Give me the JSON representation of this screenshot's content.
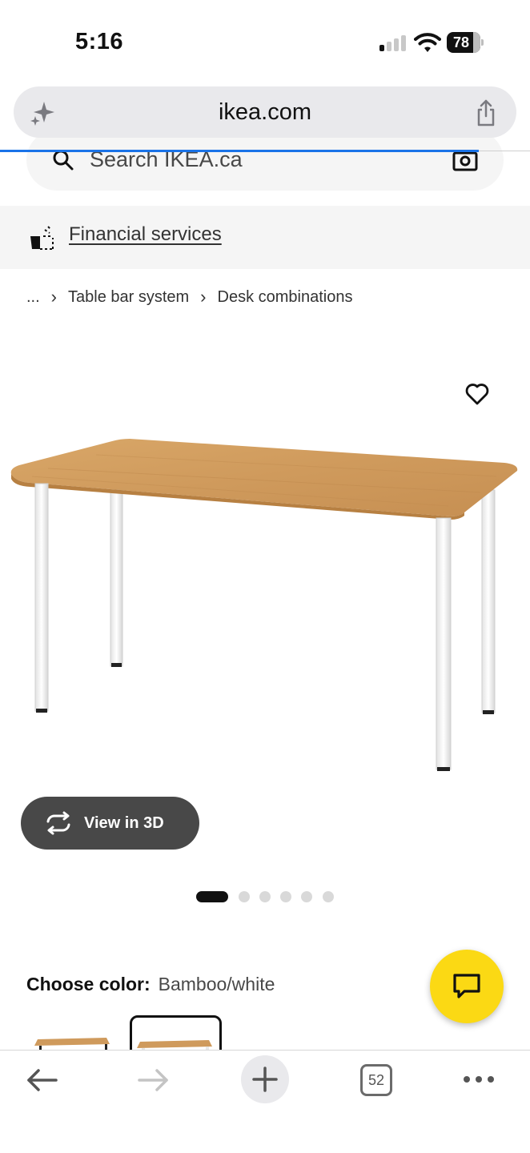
{
  "status_bar": {
    "time": "5:16",
    "battery": "78"
  },
  "browser": {
    "url": "ikea.com",
    "open_tabs": "52"
  },
  "search": {
    "placeholder": "Search IKEA.ca"
  },
  "financial": {
    "label": "Financial services"
  },
  "breadcrumb": {
    "ellipsis": "...",
    "items": [
      "Table bar system",
      "Desk combinations"
    ]
  },
  "product": {
    "view_3d_label": "View in 3D",
    "image_count": 6,
    "active_image": 1,
    "color_label": "Choose color:",
    "color_value": "Bamboo/white"
  },
  "colors": {
    "accent_blue": "#1a73e8",
    "chat_yellow": "#fbd914",
    "dark_button": "#484848"
  }
}
